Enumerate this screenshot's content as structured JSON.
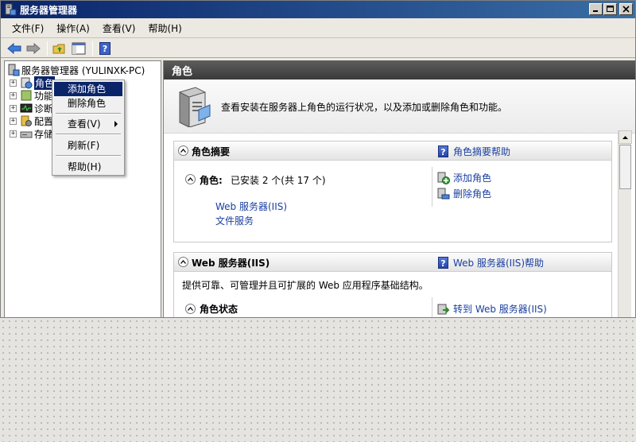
{
  "window": {
    "title": "服务器管理器"
  },
  "menubar": [
    "文件(F)",
    "操作(A)",
    "查看(V)",
    "帮助(H)"
  ],
  "tree": {
    "root": "服务器管理器 (YULINXK-PC)",
    "items": [
      "角色",
      "功能",
      "诊断",
      "配置",
      "存储"
    ]
  },
  "context_menu": {
    "items": [
      "添加角色",
      "删除角色",
      "查看(V)",
      "刷新(F)",
      "帮助(H)"
    ]
  },
  "content": {
    "header": "角色",
    "intro": "查看安装在服务器上角色的运行状况，以及添加或删除角色和功能。",
    "summary": {
      "title": "角色摘要",
      "help": "角色摘要帮助",
      "roles_label": "角色:",
      "roles_count": "已安装 2 个(共 17 个)",
      "installed": [
        "Web 服务器(IIS)",
        "文件服务"
      ],
      "actions": [
        "添加角色",
        "删除角色"
      ]
    },
    "web": {
      "title": "Web 服务器(IIS)",
      "help": "Web 服务器(IIS)帮助",
      "description": "提供可靠、可管理并且可扩展的 Web 应用程序基础结构。",
      "status_title": "角色状态",
      "goto": "转到 Web 服务器(IIS)"
    }
  }
}
